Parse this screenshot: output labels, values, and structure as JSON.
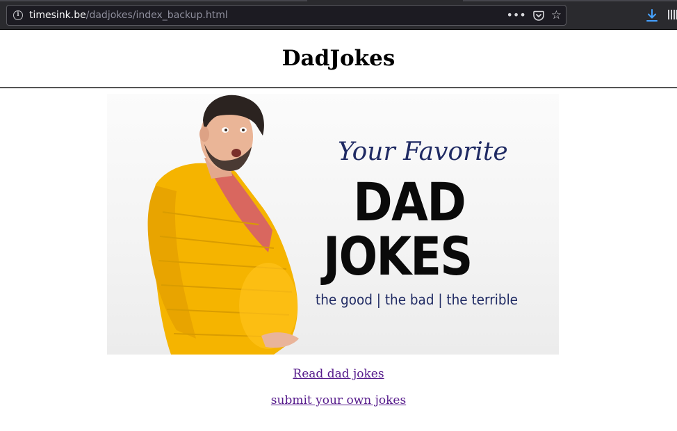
{
  "browser": {
    "url_host": "timesink.be",
    "url_path": "/dadjokes/index_backup.html",
    "icons": [
      "info-icon",
      "page-actions-icon",
      "pocket-icon",
      "bookmark-star-icon",
      "downloads-icon",
      "library-icon"
    ],
    "overflow_glyph": "•••",
    "star_glyph": "☆"
  },
  "page": {
    "title": "DadJokes",
    "banner": {
      "script_line": "Your Favorite",
      "big_line_1": "DAD",
      "big_line_2": "JOKES",
      "sub_line": "the good | the bad | the terrible"
    },
    "links": {
      "read": "Read dad jokes",
      "submit": "submit your own jokes"
    }
  },
  "colors": {
    "link_visited": "#551a8b",
    "banner_navy": "#1f2a63",
    "cardigan_yellow": "#f5b400"
  }
}
